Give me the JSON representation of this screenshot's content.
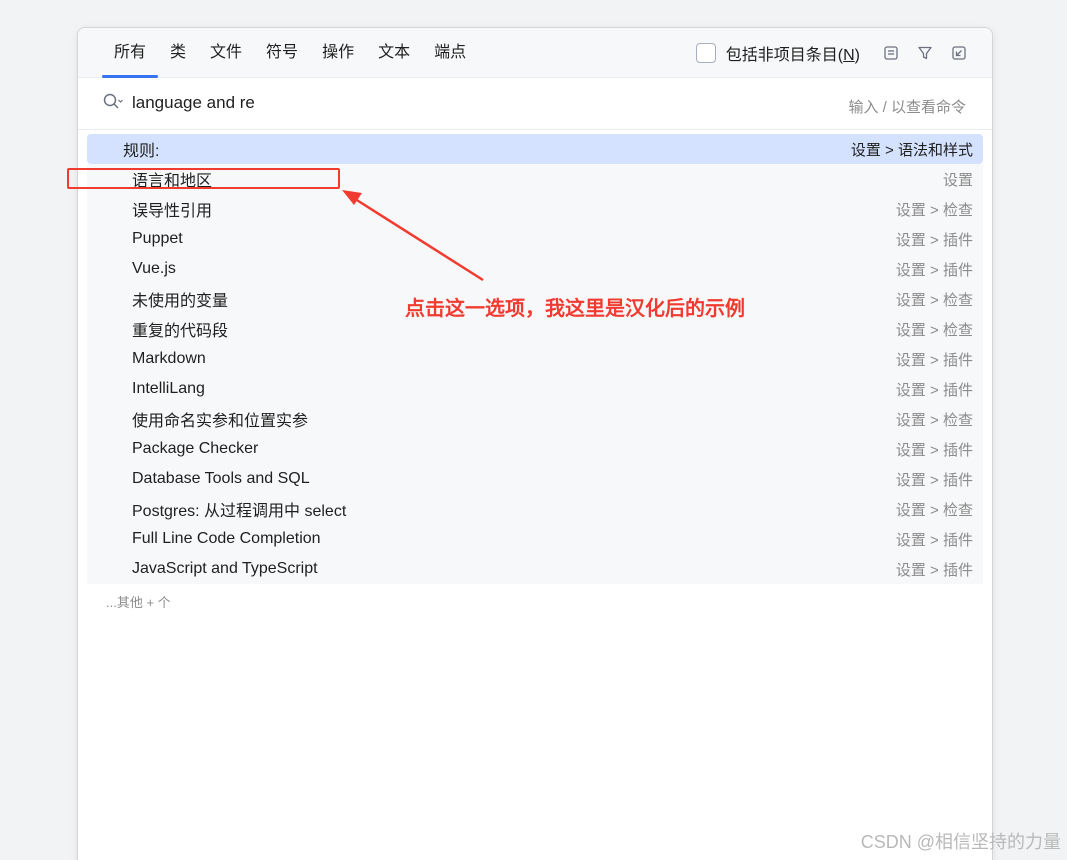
{
  "tabs": [
    {
      "label": "所有",
      "active": true
    },
    {
      "label": "类",
      "active": false
    },
    {
      "label": "文件",
      "active": false
    },
    {
      "label": "符号",
      "active": false
    },
    {
      "label": "操作",
      "active": false
    },
    {
      "label": "文本",
      "active": false
    },
    {
      "label": "端点",
      "active": false
    }
  ],
  "include_non_project": {
    "label": "包括非项目条目(",
    "mnemonic": "N",
    "label_end": ")",
    "checked": false
  },
  "toolbar_icons": [
    "preview-icon",
    "filter-icon",
    "open-in-window-icon"
  ],
  "search": {
    "value": "language and re",
    "hint": "输入 / 以查看命令"
  },
  "results": [
    {
      "name": "规则:",
      "path": "设置 > 语法和样式",
      "selected": true
    },
    {
      "name": "语言和地区",
      "path": "设置",
      "selected": false
    },
    {
      "name": "误导性引用",
      "path": "设置 > 检查",
      "selected": false
    },
    {
      "name": "Puppet",
      "path": "设置 > 插件",
      "selected": false
    },
    {
      "name": "Vue.js",
      "path": "设置 > 插件",
      "selected": false
    },
    {
      "name": "未使用的变量",
      "path": "设置 > 检查",
      "selected": false
    },
    {
      "name": "重复的代码段",
      "path": "设置 > 检查",
      "selected": false
    },
    {
      "name": "Markdown",
      "path": "设置 > 插件",
      "selected": false
    },
    {
      "name": "IntelliLang",
      "path": "设置 > 插件",
      "selected": false
    },
    {
      "name": "使用命名实参和位置实参",
      "path": "设置 > 检查",
      "selected": false
    },
    {
      "name": "Package Checker",
      "path": "设置 > 插件",
      "selected": false
    },
    {
      "name": "Database Tools and SQL",
      "path": "设置 > 插件",
      "selected": false
    },
    {
      "name": "Postgres: 从过程调用中 select",
      "path": "设置 > 检查",
      "selected": false
    },
    {
      "name": "Full Line Code Completion",
      "path": "设置 > 插件",
      "selected": false
    },
    {
      "name": "JavaScript and TypeScript",
      "path": "设置 > 插件",
      "selected": false
    }
  ],
  "more_label": "...其他 + 个",
  "annotation": {
    "text": "点击这一选项，我这里是汉化后的示例",
    "color": "#f23b30"
  },
  "watermark": "CSDN @相信坚持的力量",
  "colors": {
    "accent": "#3574f0",
    "selection": "#d4e2ff"
  }
}
